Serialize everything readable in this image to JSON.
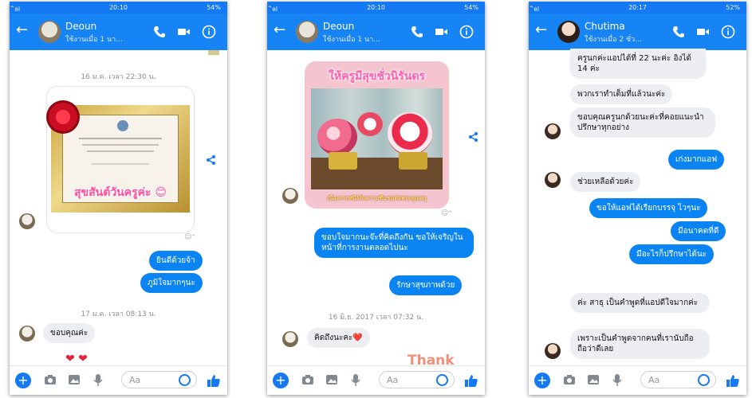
{
  "status": {
    "signal": "ิลl",
    "time_1": "20:10",
    "time_2": "20:10",
    "time_3": "20:17",
    "battery_1": "54%",
    "battery_2": "54%",
    "battery_3": "52%"
  },
  "colors": {
    "header": "#1784f6",
    "statusbar": "#1479f2",
    "outgoing": "#0b84f3",
    "incoming": "#eceef1"
  },
  "icons": [
    "back-arrow-icon",
    "phone-icon",
    "video-icon",
    "info-icon",
    "plus-icon",
    "camera-icon",
    "gallery-icon",
    "mic-icon",
    "emoji-icon",
    "like-icon",
    "share-icon"
  ],
  "composer": {
    "placeholder": "Aa"
  },
  "screen1": {
    "name": "Deoun",
    "active": "ใช้งานเมื่อ 1 นา...",
    "ts1": "16 ม.ค. เวลา 22:30 น.",
    "photo_caption": "สุขสันต์วันครูค่ะ 😊",
    "out1": "ยินดีด้วยจ้า",
    "out2": "ภูมิใจมากๆนะ",
    "ts2": "17 ม.ค. เวลา 08:13 น.",
    "in1": "ขอบคุณค่ะ"
  },
  "screen2": {
    "name": "Deoun",
    "active": "ใช้งานเมื่อ 1 นา...",
    "photo_title": "ให้ครูมีสุขชั่วนิรันดร",
    "photo_caption": "เนื่องจากหนึ่งในความชื่นชมต่อพระคุณครู",
    "out1": "ขอบใจมากนะจ๊ะที่คิดถึงกัน ขอให้เจริญในหน้าที่การงานตลอดไปนะ",
    "out2": "รักษาสุขภาพด้วย",
    "ts1": "16 มิ.ย. 2017 เวลา 07:32 น.",
    "in1": "คิดถึงนะคะ❤️",
    "sticker": "Thank"
  },
  "screen3": {
    "name": "Chutima",
    "active": "ใช้งานเมื่อ 2 ชั่ว...",
    "in1": "ครูนกค่ะแอปได้ที่ 22 นะค่ะ อิงได้ 14 ค่ะ",
    "in2": "พวกเราทำเต็มที่แล้วนะค่ะ",
    "in3": "ขอบคุณครูนกด้วยนะค่ะที่คอยแนะนำ ปรึกษาทุกอย่าง",
    "out1": "เก่งมากแอฟ",
    "in4": "ช่วยเหลือด้วยค่ะ",
    "out2": "ขอให้แอฟได้เรียกบรรจุ ไวๆนะ",
    "out3": "มีอนาคตที่ดี",
    "out4": "มีอะไรก็ปรึกษาได้นะ",
    "in5": "ค่ะ สาธุ เป็นคำพูดที่แอปดีใจมากค่ะ",
    "in6": "เพราะเป็นคำพูดจากคนที่เรานับถือ ถือว่าดีเลย"
  }
}
